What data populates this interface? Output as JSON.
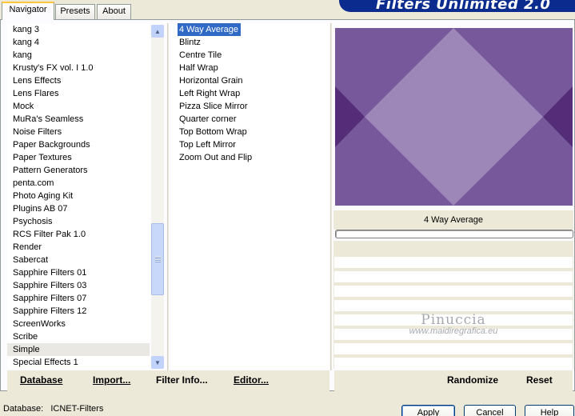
{
  "tabs": {
    "navigator": "Navigator",
    "presets": "Presets",
    "about": "About"
  },
  "banner": "Filters Unlimited 2.0",
  "categories": {
    "items": [
      "kang 3",
      "kang 4",
      "kang",
      "Krusty's FX vol. I 1.0",
      "Lens Effects",
      "Lens Flares",
      "Mock",
      "MuRa's Seamless",
      "Noise Filters",
      "Paper Backgrounds",
      "Paper Textures",
      "Pattern Generators",
      "penta.com",
      "Photo Aging Kit",
      "Plugins AB 07",
      "Psychosis",
      "RCS Filter Pak 1.0",
      "Render",
      "Sabercat",
      "Sapphire Filters 01",
      "Sapphire Filters 03",
      "Sapphire Filters 07",
      "Sapphire Filters 12",
      "ScreenWorks",
      "Scribe",
      "Simple",
      "Special Effects 1"
    ],
    "selected": "Simple"
  },
  "filters": {
    "items": [
      "4 Way Average",
      "Blintz",
      "Centre Tile",
      "Half Wrap",
      "Horizontal Grain",
      "Left Right Wrap",
      "Pizza Slice Mirror",
      "Quarter corner",
      "Top Bottom Wrap",
      "Top Left Mirror",
      "Zoom Out and Flip"
    ],
    "selected": "4 Way Average"
  },
  "preview": {
    "label": "4 Way Average",
    "colors": {
      "base": "#77589a",
      "diamond": "#9d86b8",
      "dark": "#542c78"
    }
  },
  "watermark": {
    "name": "Pinuccia",
    "url": "www.maidiregrafica.eu"
  },
  "buttons": {
    "database": "Database",
    "import": "Import...",
    "filter_info": "Filter Info...",
    "editor": "Editor...",
    "randomize": "Randomize",
    "reset": "Reset",
    "apply": "Apply",
    "cancel": "Cancel",
    "help": "Help"
  },
  "status": {
    "label": "Database:",
    "value": "ICNET-Filters"
  },
  "icons": {
    "scroll_up": "scroll-up-arrow-icon",
    "scroll_down": "scroll-down-arrow-icon"
  }
}
